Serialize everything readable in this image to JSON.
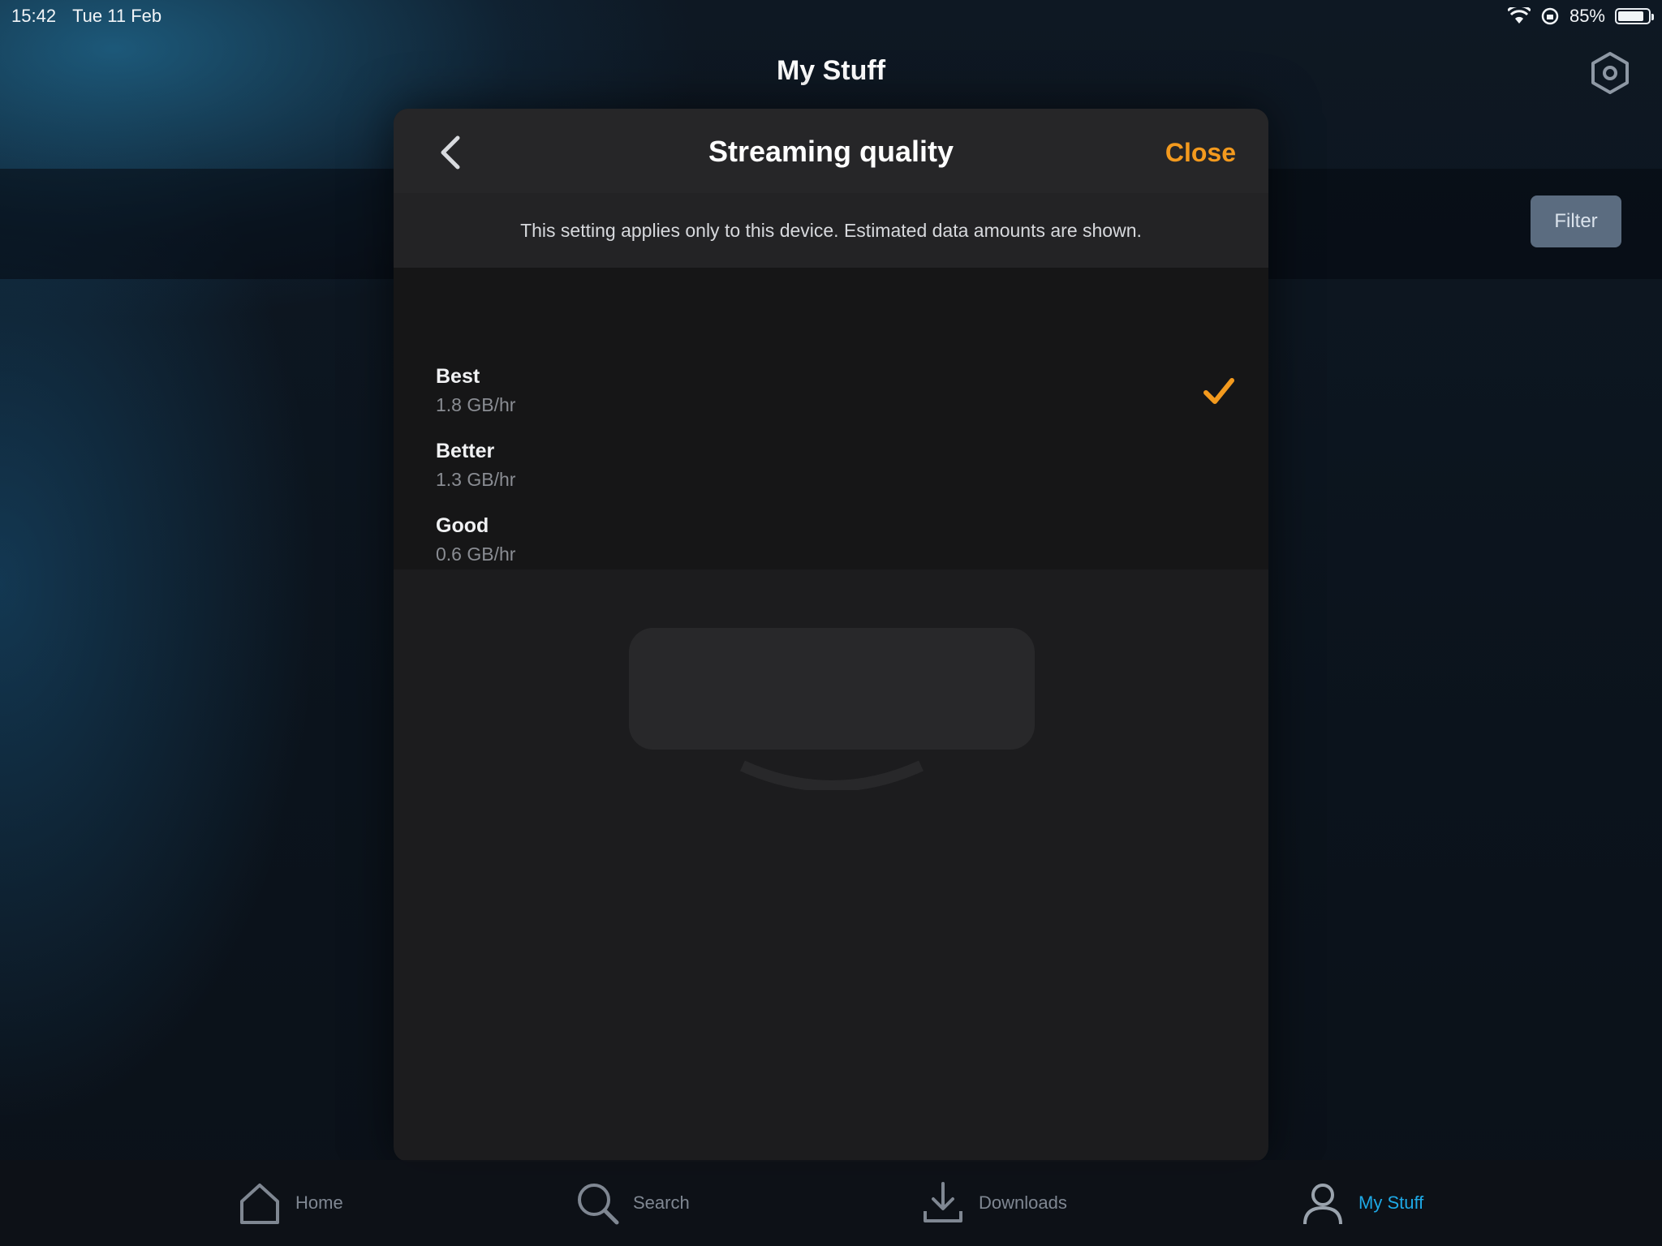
{
  "status_bar": {
    "time": "15:42",
    "date": "Tue 11 Feb",
    "battery_percent": "85%",
    "battery_level": 0.85
  },
  "header": {
    "title": "My Stuff",
    "filter_label": "Filter"
  },
  "modal": {
    "title": "Streaming quality",
    "close_label": "Close",
    "note": "This setting applies only to this device. Estimated data amounts are shown.",
    "options": [
      {
        "label": "Best",
        "detail": "1.8 GB/hr",
        "selected": true
      },
      {
        "label": "Better",
        "detail": "1.3 GB/hr",
        "selected": false
      },
      {
        "label": "Good",
        "detail": "0.6 GB/hr",
        "selected": false
      }
    ]
  },
  "tabs": [
    {
      "label": "Home",
      "icon": "home-icon",
      "active": false
    },
    {
      "label": "Search",
      "icon": "search-icon",
      "active": false
    },
    {
      "label": "Downloads",
      "icon": "download-icon",
      "active": false
    },
    {
      "label": "My Stuff",
      "icon": "profile-icon",
      "active": true
    }
  ],
  "colors": {
    "accent": "#f39a1e",
    "active_tab": "#1ea9e6",
    "modal_bg": "#1c1c1e"
  }
}
